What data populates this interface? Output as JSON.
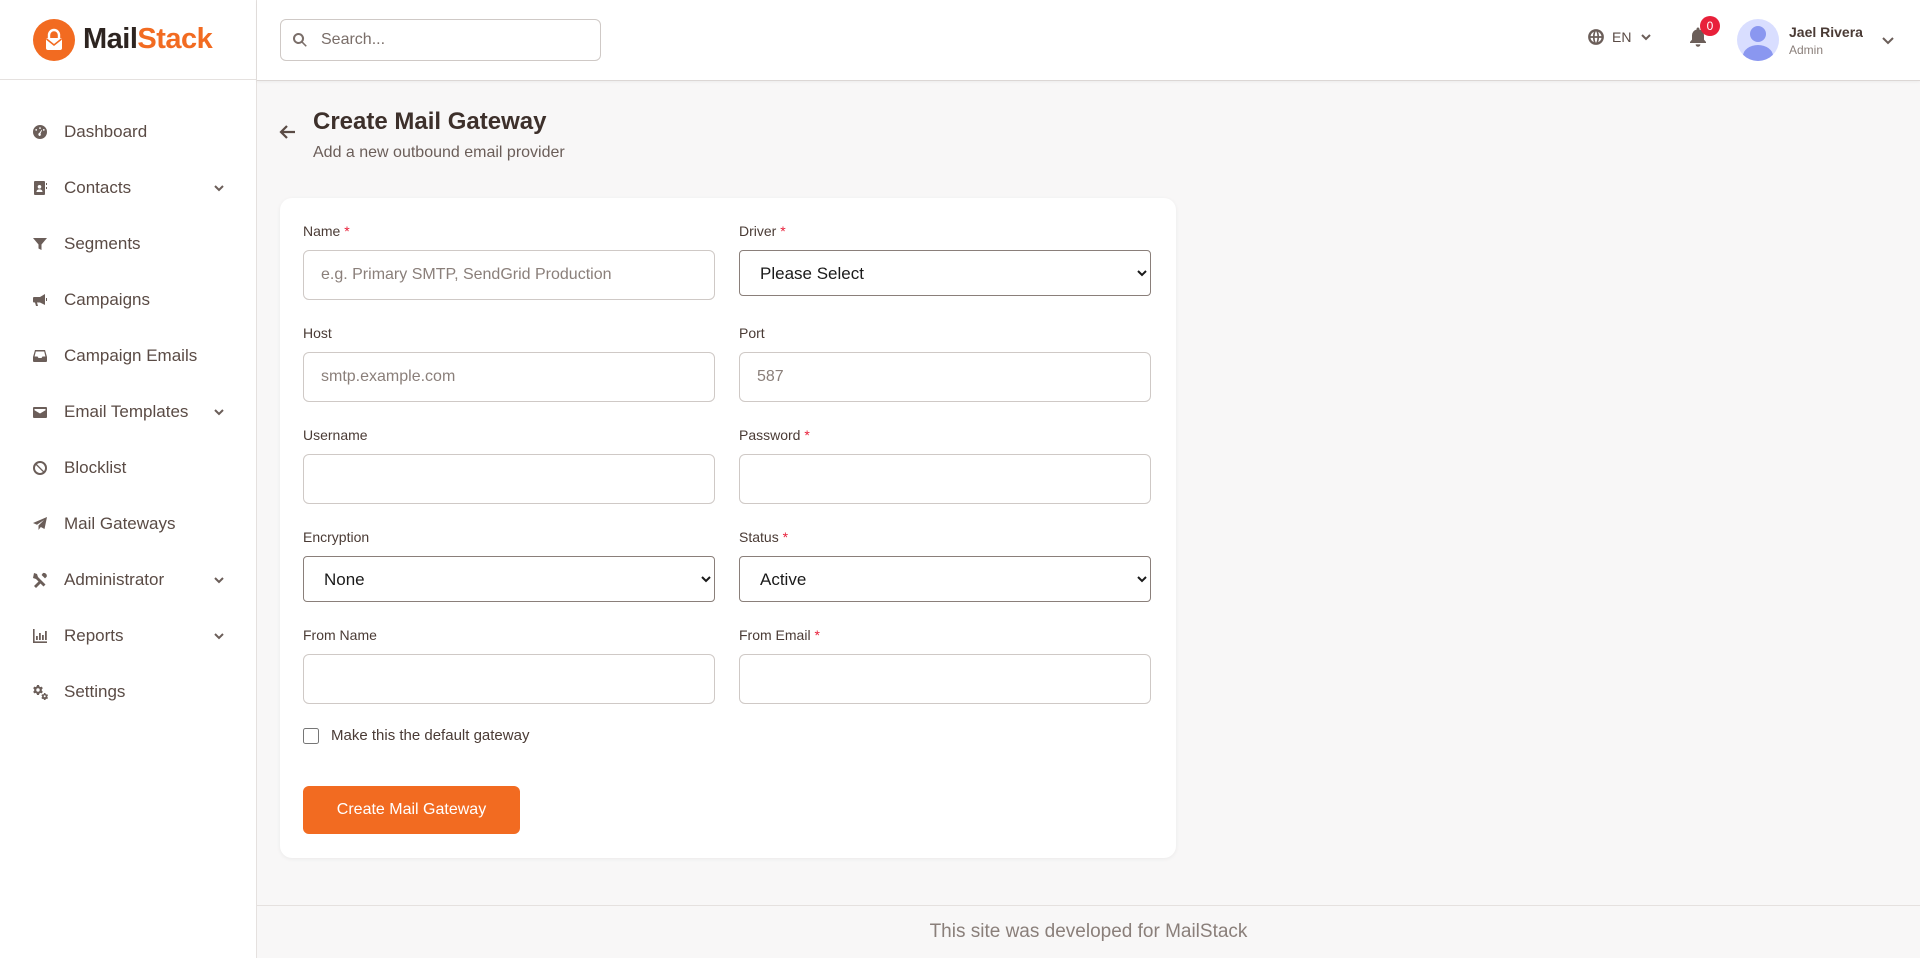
{
  "brand": {
    "name_part1": "Mail",
    "name_part2": "Stack",
    "accent_color": "#f26b21"
  },
  "sidebar": {
    "items": [
      {
        "label": "Dashboard",
        "icon": "dashboard-gauge-icon",
        "has_submenu": false
      },
      {
        "label": "Contacts",
        "icon": "address-book-icon",
        "has_submenu": true
      },
      {
        "label": "Segments",
        "icon": "funnel-icon",
        "has_submenu": false
      },
      {
        "label": "Campaigns",
        "icon": "megaphone-icon",
        "has_submenu": false
      },
      {
        "label": "Campaign Emails",
        "icon": "inbox-icon",
        "has_submenu": false
      },
      {
        "label": "Email Templates",
        "icon": "envelope-open-icon",
        "has_submenu": true
      },
      {
        "label": "Blocklist",
        "icon": "ban-icon",
        "has_submenu": false
      },
      {
        "label": "Mail Gateways",
        "icon": "paper-plane-icon",
        "has_submenu": false
      },
      {
        "label": "Administrator",
        "icon": "tools-icon",
        "has_submenu": true
      },
      {
        "label": "Reports",
        "icon": "bar-chart-icon",
        "has_submenu": true
      },
      {
        "label": "Settings",
        "icon": "gears-icon",
        "has_submenu": false
      }
    ]
  },
  "topbar": {
    "search_placeholder": "Search...",
    "language": "EN",
    "notification_count": "0",
    "user_name": "Jael Rivera",
    "user_role": "Admin"
  },
  "page": {
    "title": "Create Mail Gateway",
    "subtitle": "Add a new outbound email provider"
  },
  "form": {
    "name": {
      "label": "Name",
      "placeholder": "e.g. Primary SMTP, SendGrid Production",
      "value": ""
    },
    "driver": {
      "label": "Driver",
      "selected": "Please Select"
    },
    "host": {
      "label": "Host",
      "placeholder": "smtp.example.com",
      "value": ""
    },
    "port": {
      "label": "Port",
      "placeholder": "587",
      "value": ""
    },
    "username": {
      "label": "Username",
      "value": ""
    },
    "password": {
      "label": "Password",
      "value": ""
    },
    "encryption": {
      "label": "Encryption",
      "selected": "None"
    },
    "status": {
      "label": "Status",
      "selected": "Active"
    },
    "from_name": {
      "label": "From Name",
      "value": ""
    },
    "from_email": {
      "label": "From Email",
      "value": ""
    },
    "default_checkbox": {
      "label": "Make this the default gateway",
      "checked": false
    },
    "submit_label": "Create Mail Gateway",
    "required_mark": "*"
  },
  "footer": {
    "text": "This site was developed for MailStack"
  },
  "colors": {
    "accent": "#f26b21",
    "badge": "#e8203a",
    "required": "#e8203a"
  }
}
